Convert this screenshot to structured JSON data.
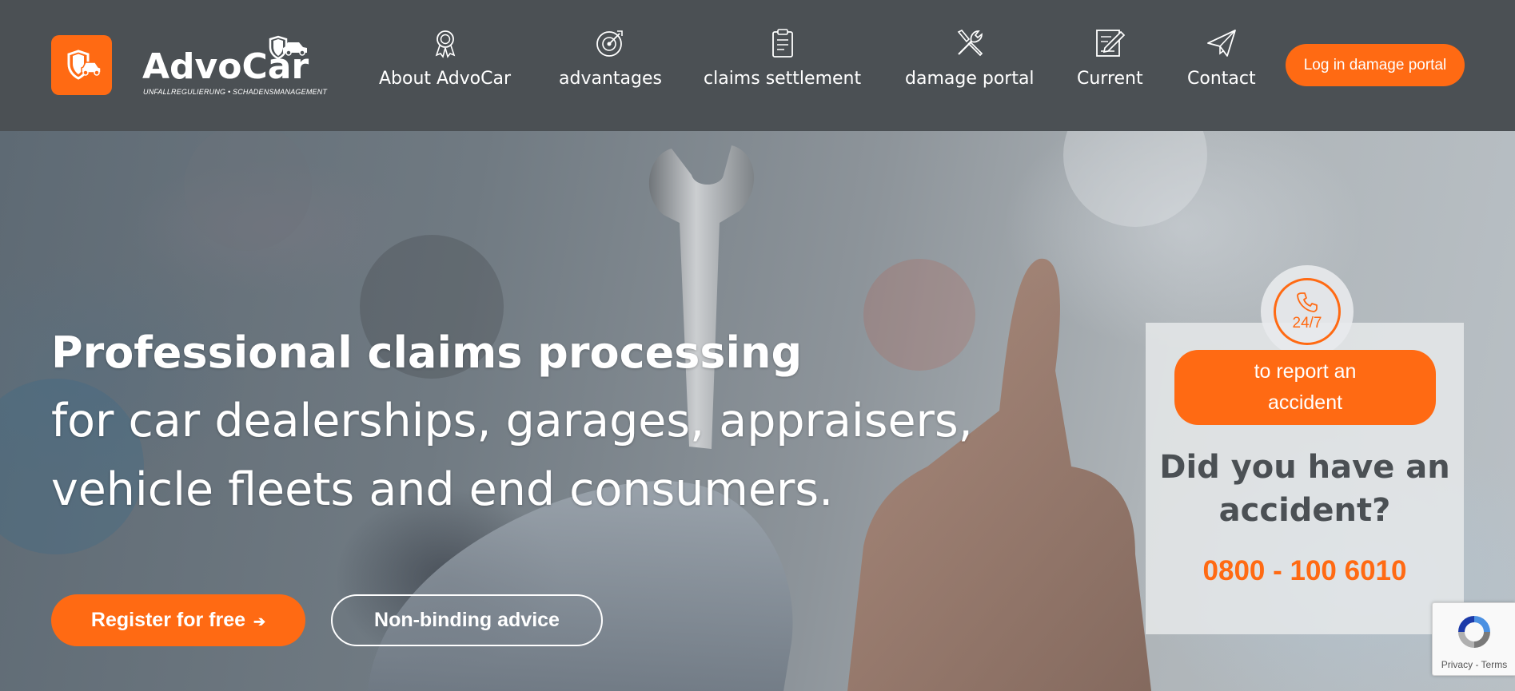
{
  "brand": {
    "name": "AdvoCar",
    "tagline": "UNFALLREGULIERUNG • SCHADENSMANAGEMENT",
    "accent_color": "#ff6a13",
    "header_bg": "#4b5054"
  },
  "nav": {
    "items": [
      {
        "label": "About AdvoCar",
        "icon": "award-ribbon-icon"
      },
      {
        "label": "advantages",
        "icon": "target-icon"
      },
      {
        "label": "claims settlement",
        "icon": "clipboard-icon"
      },
      {
        "label": "damage portal",
        "icon": "tools-icon"
      },
      {
        "label": "Current",
        "icon": "edit-document-icon"
      },
      {
        "label": "Contact",
        "icon": "paper-plane-icon"
      }
    ],
    "login_label": "Log in damage portal"
  },
  "hero": {
    "title": "Professional claims processing",
    "subtitle": "for car dealerships, garages, appraisers, vehicle fleets and end consumers.",
    "register_label": "Register for free",
    "register_arrow": "➔",
    "advice_label": "Non-binding advice"
  },
  "accident_card": {
    "badge_text": "24/7",
    "report_label": "to report an accident",
    "question": "Did you have an accident?",
    "phone": "0800 - 100 6010"
  },
  "recaptcha": {
    "links": "Privacy - Terms"
  }
}
